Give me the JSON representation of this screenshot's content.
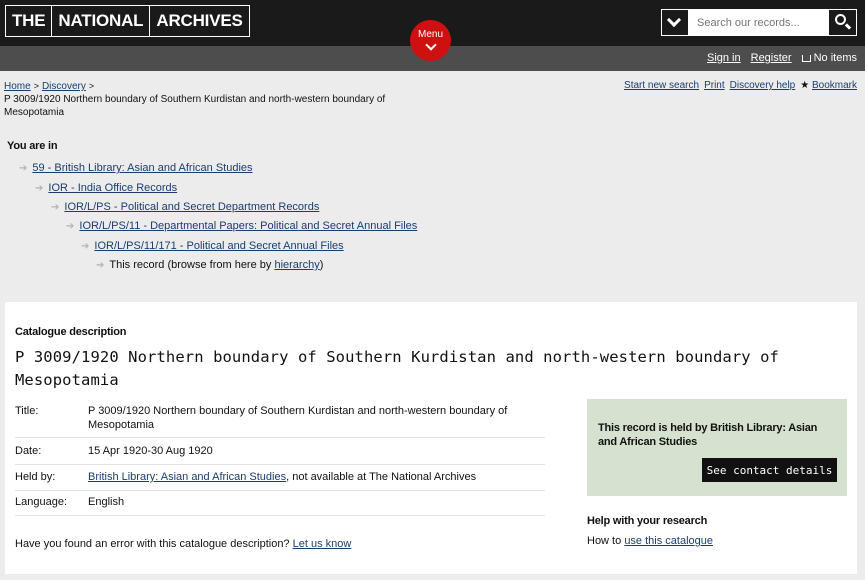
{
  "header": {
    "logo": [
      "THE",
      "NATIONAL",
      "ARCHIVES"
    ],
    "menu_label": "Menu",
    "search_placeholder": "Search our records..."
  },
  "user_bar": {
    "sign_in": "Sign in",
    "register": "Register",
    "cart": "No items"
  },
  "breadcrumb": {
    "home": "Home",
    "discovery": "Discovery",
    "current": "P 3009/1920 Northern boundary of Southern Kurdistan and north-western boundary of Mesopotamia"
  },
  "toolbar": {
    "new_search": "Start new search",
    "print": "Print",
    "help": "Discovery help",
    "bookmark": "Bookmark"
  },
  "you_are_in": {
    "heading": "You are in",
    "items": [
      "59 - British Library: Asian and African Studies",
      "IOR - India Office Records",
      "IOR/L/PS - Political and Secret Department Records",
      "IOR/L/PS/11 - Departmental Papers: Political and Secret Annual Files",
      "IOR/L/PS/11/171 - Political and Secret Annual Files"
    ],
    "this_record_prefix": "This record (browse from here by ",
    "hierarchy_link": "hierarchy",
    "this_record_suffix": ")"
  },
  "record": {
    "section_label": "Catalogue description",
    "title": "P 3009/1920 Northern boundary of Southern Kurdistan and north-western boundary of Mesopotamia",
    "fields": {
      "title_key": "Title:",
      "title_val": "P 3009/1920 Northern boundary of Southern Kurdistan and north-western boundary of Mesopotamia",
      "date_key": "Date:",
      "date_val": "15 Apr 1920-30 Aug 1920",
      "held_key": "Held by:",
      "held_link": "British Library: Asian and African Studies",
      "held_suffix": ", not available at The National Archives",
      "lang_key": "Language:",
      "lang_val": "English"
    },
    "error_prompt": "Have you found an error with this catalogue description?",
    "error_link": "Let us know"
  },
  "held_box": {
    "text": "This record is held by British Library: Asian and African Studies",
    "button": "See contact details"
  },
  "help": {
    "heading": "Help with your research",
    "prefix": "How to",
    "link": "use this catalogue"
  }
}
